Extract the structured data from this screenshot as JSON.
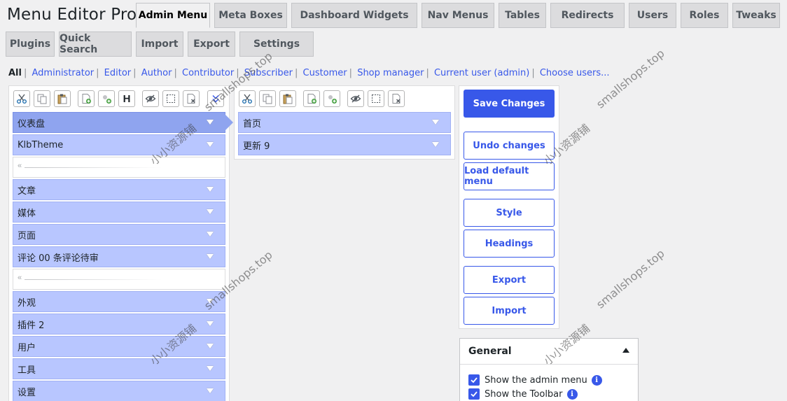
{
  "app_title": "Menu Editor Pro",
  "tabs_row1": [
    {
      "label": "Admin Menu",
      "active": true
    },
    {
      "label": "Meta Boxes"
    },
    {
      "label": "Dashboard Widgets"
    },
    {
      "label": "Nav Menus"
    },
    {
      "label": "Tables"
    },
    {
      "label": "Redirects"
    },
    {
      "label": "Users"
    },
    {
      "label": "Roles"
    },
    {
      "label": "Tweaks"
    }
  ],
  "tabs_row2": [
    {
      "label": "Plugins"
    },
    {
      "label": "Quick Search"
    },
    {
      "label": "Import"
    },
    {
      "label": "Export"
    },
    {
      "label": "Settings"
    }
  ],
  "roles": {
    "all": "All",
    "links": [
      "Administrator",
      "Editor",
      "Author",
      "Contributor",
      "Subscriber",
      "Customer",
      "Shop manager",
      "Current user (admin)",
      "Choose users..."
    ]
  },
  "menu_left": [
    {
      "label": "仪表盘",
      "selected": true
    },
    {
      "label": "KlbTheme"
    },
    {
      "separator": true
    },
    {
      "label": "文章"
    },
    {
      "label": "媒体"
    },
    {
      "label": "页面"
    },
    {
      "label": "评论 00 条评论待审"
    },
    {
      "separator": true
    },
    {
      "label": "外观"
    },
    {
      "label": "插件 2"
    },
    {
      "label": "用户"
    },
    {
      "label": "工具"
    },
    {
      "label": "设置"
    }
  ],
  "menu_right": [
    {
      "label": "首页"
    },
    {
      "label": "更新 9"
    }
  ],
  "separator_glyph": "«",
  "toolbar_icons": {
    "cut": "scissors-icon",
    "copy": "copy-icon",
    "paste": "paste-icon",
    "new_item": "new-item-icon",
    "new_separator": "new-separator-icon",
    "new_heading": "H",
    "hide": "hide-icon",
    "select": "select-icon",
    "delete": "delete-icon",
    "more": "expand-more-icon"
  },
  "actions": {
    "save": "Save Changes",
    "undo": "Undo changes",
    "load_default": "Load default menu",
    "style": "Style",
    "headings": "Headings",
    "export": "Export",
    "import": "Import"
  },
  "general": {
    "title": "General",
    "options": [
      {
        "label": "Show the admin menu",
        "checked": true
      },
      {
        "label": "Show the Toolbar",
        "checked": true
      }
    ],
    "info_glyph": "i"
  },
  "watermarks": {
    "site": "smallshops.top",
    "cn": "小小资源铺"
  },
  "colors": {
    "accent": "#3858e9",
    "item_bg": "#b8c6ff",
    "item_selected": "#8fa4ef"
  }
}
